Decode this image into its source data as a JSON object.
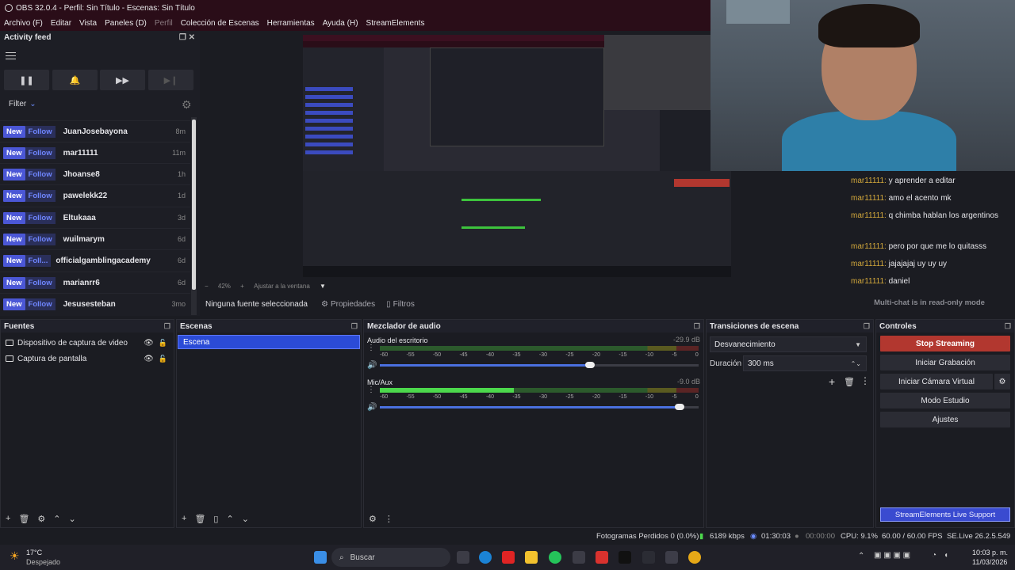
{
  "window": {
    "title": "OBS 32.0.4 - Perfil: Sin Título - Escenas: Sin Título"
  },
  "menu": [
    "Archivo (F)",
    "Editar",
    "Vista",
    "Paneles (D)",
    "Perfil",
    "Colección de Escenas",
    "Herramientas",
    "Ayuda (H)",
    "StreamElements"
  ],
  "activity_feed": {
    "title": "Activity feed",
    "filter_label": "Filter",
    "tag_new": "New",
    "items": [
      {
        "type": "Follow",
        "name": "JuanJosebayona",
        "time": "8m"
      },
      {
        "type": "Follow",
        "name": "mar11111",
        "time": "11m"
      },
      {
        "type": "Follow",
        "name": "Jhoanse8",
        "time": "1h"
      },
      {
        "type": "Follow",
        "name": "pawelekk22",
        "time": "1d"
      },
      {
        "type": "Follow",
        "name": "Eltukaaa",
        "time": "3d"
      },
      {
        "type": "Follow",
        "name": "wuilmarym",
        "time": "6d"
      },
      {
        "type": "Foll...",
        "name": "officialgamblingacademy",
        "time": "6d"
      },
      {
        "type": "Follow",
        "name": "marianrr6",
        "time": "6d"
      },
      {
        "type": "Follow",
        "name": "Jesusesteban",
        "time": "3mo"
      }
    ]
  },
  "preview": {
    "zoom": "42%",
    "fit_label": "Ajustar a la ventana"
  },
  "chat": {
    "messages": [
      {
        "user": "mar11111:",
        "text": "y aprender a editar"
      },
      {
        "user": "mar11111:",
        "text": "amo el acento mk"
      },
      {
        "user": "mar11111:",
        "text": "q chimba hablan los argentinos"
      },
      {
        "user": "mar11111:",
        "text": "pero por que me lo quitasss"
      },
      {
        "user": "mar11111:",
        "text": "jajajajaj uy uy uy"
      },
      {
        "user": "mar11111:",
        "text": "daniel"
      }
    ],
    "readonly": "Multi-chat is in read-only mode"
  },
  "source_bar": {
    "no_source": "Ninguna fuente seleccionada",
    "properties": "Propiedades",
    "filters": "Filtros"
  },
  "sources": {
    "title": "Fuentes",
    "items": [
      "Dispositivo de captura de video",
      "Captura de pantalla"
    ]
  },
  "scenes": {
    "title": "Escenas",
    "items": [
      "Escena"
    ]
  },
  "mixer": {
    "title": "Mezclador de audio",
    "ticks": [
      "-60",
      "-55",
      "-50",
      "-45",
      "-40",
      "-35",
      "-30",
      "-25",
      "-20",
      "-15",
      "-10",
      "-5",
      "0"
    ],
    "channels": [
      {
        "name": "Audio del escritorio",
        "db": "-29.9 dB",
        "level": 0.0,
        "volume": 0.66
      },
      {
        "name": "Mic/Aux",
        "db": "-9.0 dB",
        "level": 0.42,
        "volume": 0.94
      }
    ]
  },
  "transitions": {
    "title": "Transiciones de escena",
    "selected": "Desvanecimiento",
    "duration_label": "Duración",
    "duration_value": "300 ms"
  },
  "controls": {
    "title": "Controles",
    "stop_streaming": "Stop Streaming",
    "start_recording": "Iniciar Grabación",
    "start_virtual_cam": "Iniciar Cámara Virtual",
    "studio_mode": "Modo Estudio",
    "settings": "Ajustes",
    "se_support": "StreamElements Live Support"
  },
  "status": {
    "dropped": "Fotogramas Perdidos 0 (0.0%)",
    "bitrate": "6189 kbps",
    "stream_time": "01:30:03",
    "rec_time": "00:00:00",
    "cpu": "CPU: 9.1%",
    "fps": "60.00 / 60.00 FPS",
    "se_version": "SE.Live 26.2.5.549"
  },
  "taskbar": {
    "weather_temp": "17°C",
    "weather_desc": "Despejado",
    "search_placeholder": "Buscar",
    "time": "10:03 p. m.",
    "date": "11/03/2026"
  },
  "colors": {
    "accent": "#4b57d6",
    "stop": "#b2372f",
    "titlebar": "#2a0d18",
    "chat_user": "#d3a83b"
  }
}
